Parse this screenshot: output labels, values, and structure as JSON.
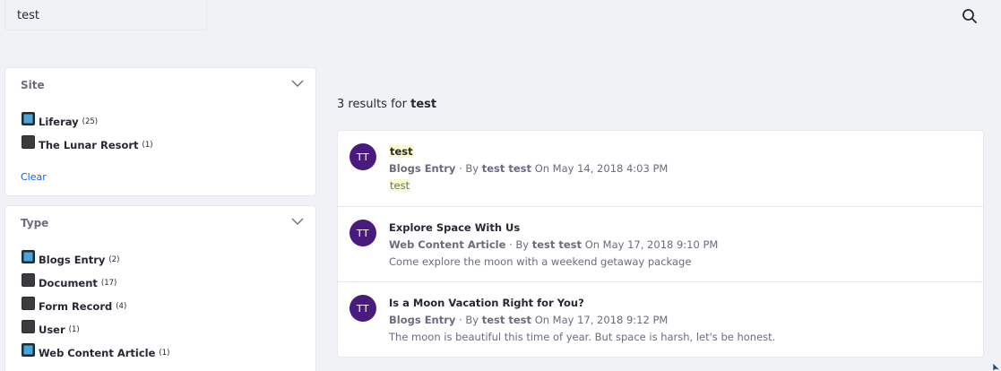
{
  "search": {
    "query": "test",
    "button_icon": "search-icon"
  },
  "facets": {
    "site": {
      "title": "Site",
      "items": [
        {
          "label": "Liferay",
          "count": "(25)",
          "checked": true
        },
        {
          "label": "The Lunar Resort",
          "count": "(1)",
          "checked": false
        }
      ],
      "clear_label": "Clear"
    },
    "type": {
      "title": "Type",
      "items": [
        {
          "label": "Blogs Entry",
          "count": "(2)",
          "checked": true
        },
        {
          "label": "Document",
          "count": "(17)",
          "checked": false
        },
        {
          "label": "Form Record",
          "count": "(4)",
          "checked": false
        },
        {
          "label": "User",
          "count": "(1)",
          "checked": false
        },
        {
          "label": "Web Content Article",
          "count": "(1)",
          "checked": true
        }
      ]
    }
  },
  "results_summary": {
    "prefix": "3 results for",
    "keyword": "test"
  },
  "results": [
    {
      "initials": "TT",
      "title": "test",
      "type": "Blogs Entry",
      "by_prefix": "· By",
      "author": "test test",
      "date": "On May 14, 2018 4:03 PM",
      "description": "test"
    },
    {
      "initials": "TT",
      "title": "Explore Space With Us",
      "type": "Web Content Article",
      "by_prefix": "· By",
      "author": "test test",
      "date": "On May 17, 2018 9:10 PM",
      "description": "Come explore the moon with a weekend getaway package"
    },
    {
      "initials": "TT",
      "title": "Is a Moon Vacation Right for You?",
      "type": "Blogs Entry",
      "by_prefix": "· By",
      "author": "test test",
      "date": "On May 17, 2018 9:12 PM",
      "description": "The moon is beautiful this time of year. But space is harsh, let's be honest."
    }
  ],
  "colors": {
    "avatar": "#4a1b7e",
    "link": "#0b5fff",
    "highlight": "#fbfccd",
    "checked": "#4aa4d9"
  }
}
